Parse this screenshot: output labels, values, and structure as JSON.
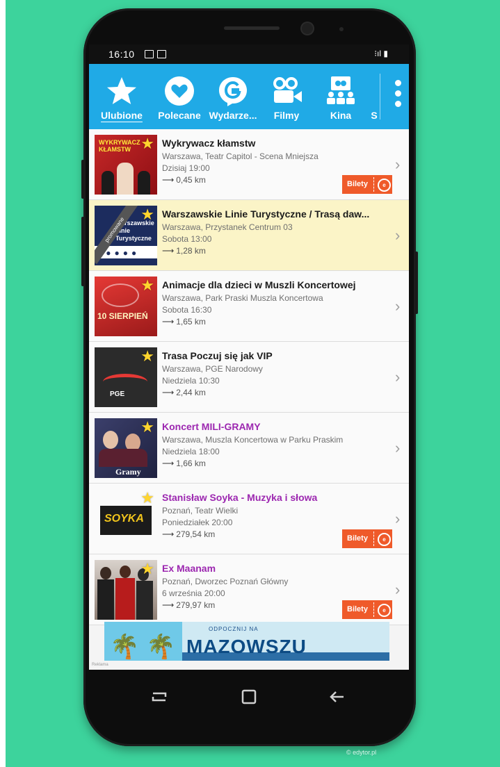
{
  "status_bar": {
    "time": "16:10",
    "right": "⁝ıl ▮"
  },
  "toolbar": {
    "tabs": [
      {
        "label": "Ulubione",
        "icon": "star-icon"
      },
      {
        "label": "Polecane",
        "icon": "heart-icon"
      },
      {
        "label": "Wydarze...",
        "icon": "event-icon"
      },
      {
        "label": "Filmy",
        "icon": "camera-icon"
      },
      {
        "label": "Kina",
        "icon": "cinema-icon"
      },
      {
        "label": "S",
        "icon": ""
      }
    ]
  },
  "events": [
    {
      "title": "Wykrywacz kłamstw",
      "place": "Warszawa, Teatr Capitol - Scena Mniejsza",
      "when": "Dzisiaj 19:00",
      "distance": "0,45 km",
      "tickets": "Bilety",
      "highlight": false,
      "promoted": false
    },
    {
      "title": "Warszawskie Linie Turystyczne / Trasą daw...",
      "place": "Warszawa, Przystanek Centrum 03",
      "when": "Sobota 13:00",
      "distance": "1,28 km",
      "tickets": "",
      "highlight": false,
      "promoted": true,
      "promo_label": "promowane"
    },
    {
      "title": "Animacje dla dzieci w Muszli Koncertowej",
      "place": "Warszawa, Park Praski Muszla Koncertowa",
      "when": "Sobota 16:30",
      "distance": "1,65 km",
      "tickets": "",
      "highlight": false,
      "promoted": false
    },
    {
      "title": "Trasa Poczuj się jak VIP",
      "place": "Warszawa, PGE Narodowy",
      "when": "Niedziela 10:30",
      "distance": "2,44 km",
      "tickets": "",
      "highlight": false,
      "promoted": false
    },
    {
      "title": "Koncert MILI-GRAMY",
      "place": "Warszawa, Muszla Koncertowa w Parku Praskim",
      "when": "Niedziela 18:00",
      "distance": "1,66 km",
      "tickets": "",
      "highlight": true,
      "promoted": false
    },
    {
      "title": "Stanisław Soyka - Muzyka i słowa",
      "place": "Poznań, Teatr Wielki",
      "when": "Poniedziałek 20:00",
      "distance": "279,54 km",
      "tickets": "Bilety",
      "highlight": true,
      "promoted": false
    },
    {
      "title": "Ex Maanam",
      "place": "Poznań, Dworzec Poznań Główny",
      "when": "6 września 20:00",
      "distance": "279,97 km",
      "tickets": "Bilety",
      "highlight": true,
      "promoted": false
    }
  ],
  "thumbs": {
    "t0": "WYKRYWACZ KŁAMSTW",
    "t1": "Warszawskie Linie Turystyczne",
    "t2": "10 SIERPIEŃ",
    "t3": "PGE",
    "t4": "Gramy",
    "t5": "SOYKA"
  },
  "banner": {
    "small": "ODPOCZNIJ NA",
    "big": "MAZOWSZU",
    "note": "Reklama"
  },
  "colors": {
    "accent": "#20aae6",
    "highlight_text": "#9c27b0",
    "tickets": "#ef5a2a",
    "promo_bg": "#fbf4c7"
  },
  "watermark": "© edytor.pl"
}
